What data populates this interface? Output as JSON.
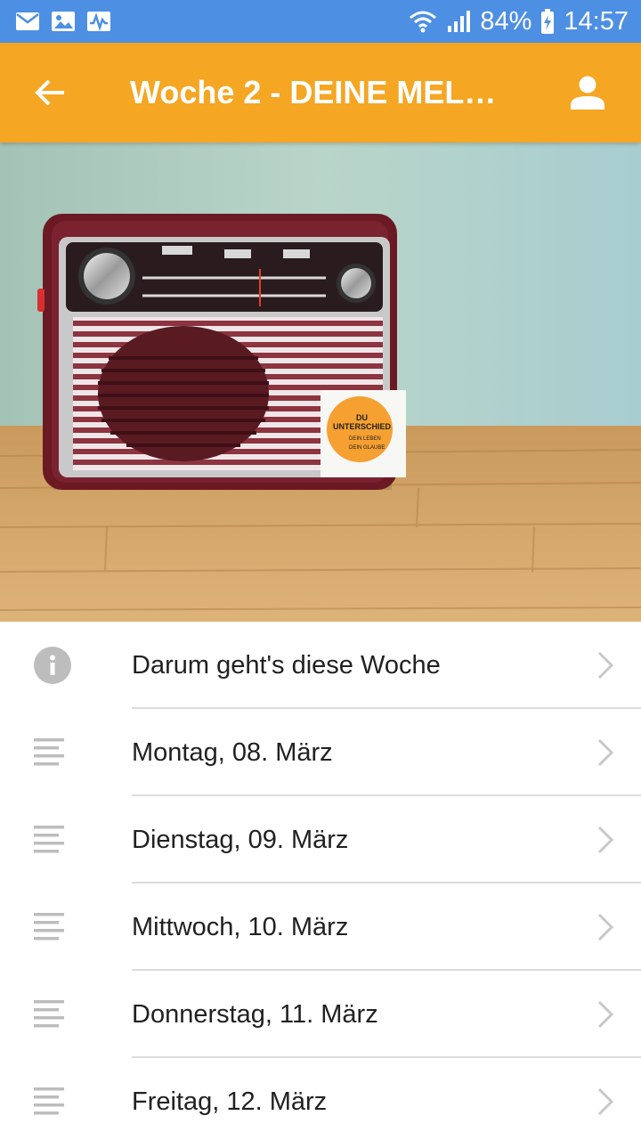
{
  "status_bar": {
    "battery": "84%",
    "time": "14:57",
    "left_icons": [
      "mail-icon",
      "image-icon",
      "activity-icon"
    ],
    "right_icons": [
      "wifi-icon",
      "signal-icon",
      "battery-charging-icon"
    ]
  },
  "app_bar": {
    "title": "Woche 2 - DEINE MEL…",
    "back_icon": "arrow-left-icon",
    "profile_icon": "person-icon"
  },
  "hero": {
    "sticker_lines": [
      "DU",
      "UNTERSCHIED",
      "DEIN LEBEN",
      "DEIN GLAUBE"
    ]
  },
  "items": [
    {
      "label": "Darum geht's diese Woche",
      "icon": "info-icon"
    },
    {
      "label": "Montag, 08. März",
      "icon": "text-lines-icon"
    },
    {
      "label": "Dienstag, 09. März",
      "icon": "text-lines-icon"
    },
    {
      "label": "Mittwoch, 10. März",
      "icon": "text-lines-icon"
    },
    {
      "label": "Donnerstag, 11. März",
      "icon": "text-lines-icon"
    },
    {
      "label": "Freitag, 12. März",
      "icon": "text-lines-icon"
    }
  ],
  "colors": {
    "status_bar": "#4d8fe3",
    "app_bar": "#f5a623",
    "text": "#212121",
    "icon_gray": "#bdbdbd"
  }
}
